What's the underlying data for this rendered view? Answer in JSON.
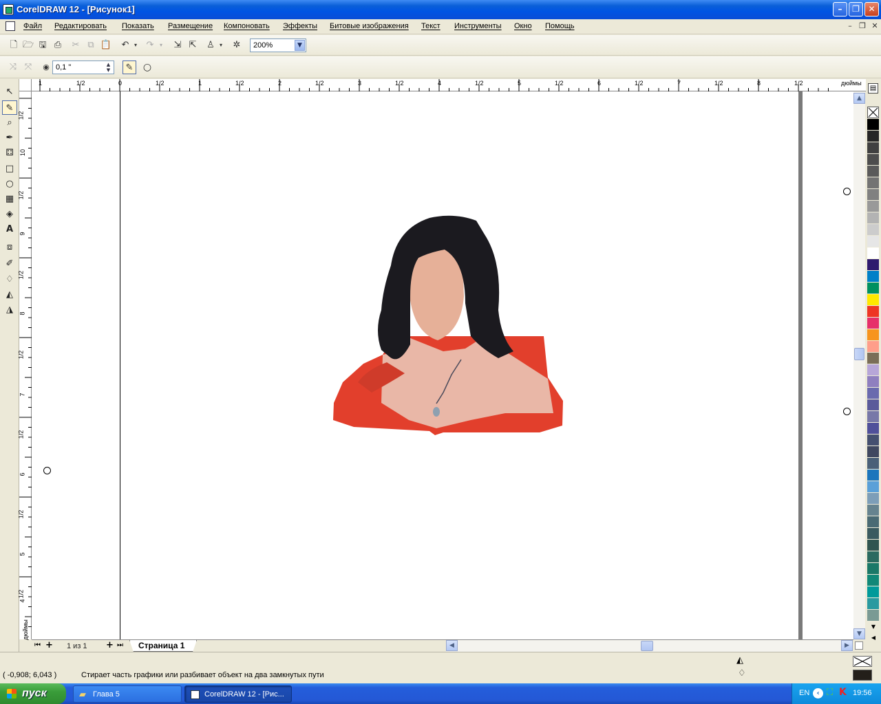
{
  "window": {
    "title": "CorelDRAW 12 - [Рисунок1]"
  },
  "menu": {
    "items": [
      "Файл",
      "Редактировать",
      "Показать",
      "Размещение",
      "Компоновать",
      "Эффекты",
      "Битовые изображения",
      "Текст",
      "Инструменты",
      "Окно",
      "Помощь"
    ]
  },
  "standard_toolbar": {
    "zoom_value": "200%"
  },
  "property_bar": {
    "eraser_thickness": "0,1 \""
  },
  "rulers": {
    "units": "дюймы",
    "horizontal_labels": [
      "1",
      "1/2",
      "0",
      "1/2",
      "1",
      "1/2",
      "2",
      "1/2",
      "3",
      "1/2",
      "4",
      "1/2",
      "5",
      "1/2",
      "6",
      "1/2",
      "7",
      "1/2",
      "8",
      "1/2"
    ],
    "vertical_labels": [
      "1/2",
      "10",
      "1/2",
      "9",
      "1/2",
      "8",
      "1/2",
      "7",
      "1/2",
      "6",
      "1/2",
      "5",
      "1/2",
      "4",
      "1/2"
    ]
  },
  "page_nav": {
    "counter": "1 из 1",
    "tab_label": "Страница 1"
  },
  "status": {
    "coordinates": "( -0,908; 6,043 )",
    "hint": "Стирает часть графики или разбивает объект на два замкнутых пути"
  },
  "taskbar": {
    "start_label": "пуск",
    "button_folder": "Глава 5",
    "button_app": "CorelDRAW 12 - [Рис...",
    "language": "EN",
    "clock": "19:56"
  },
  "palette": {
    "colors": [
      "#000000",
      "#262626",
      "#404040",
      "#4d4d4d",
      "#5a5a5a",
      "#737373",
      "#808080",
      "#999999",
      "#b3b3b3",
      "#cccccc",
      "#e6e6e6",
      "#ffffff",
      "#2e1a6e",
      "#0080c8",
      "#009060",
      "#ffe800",
      "#ee3524",
      "#e6306a",
      "#f7941d",
      "#ff9e8a",
      "#7a6e58",
      "#b7a6d8",
      "#8f7fbf",
      "#6a6aae",
      "#5a5a9a",
      "#7878a8",
      "#50509a",
      "#455070",
      "#404860",
      "#4a6078",
      "#1b75bc",
      "#5aa0d8",
      "#7d9eb8",
      "#66838f",
      "#4a6a74",
      "#3a5a60",
      "#2f5450",
      "#2a6a60",
      "#1a7868",
      "#108878",
      "#009a9a",
      "#2a9aa0",
      "#7a9a94"
    ]
  }
}
